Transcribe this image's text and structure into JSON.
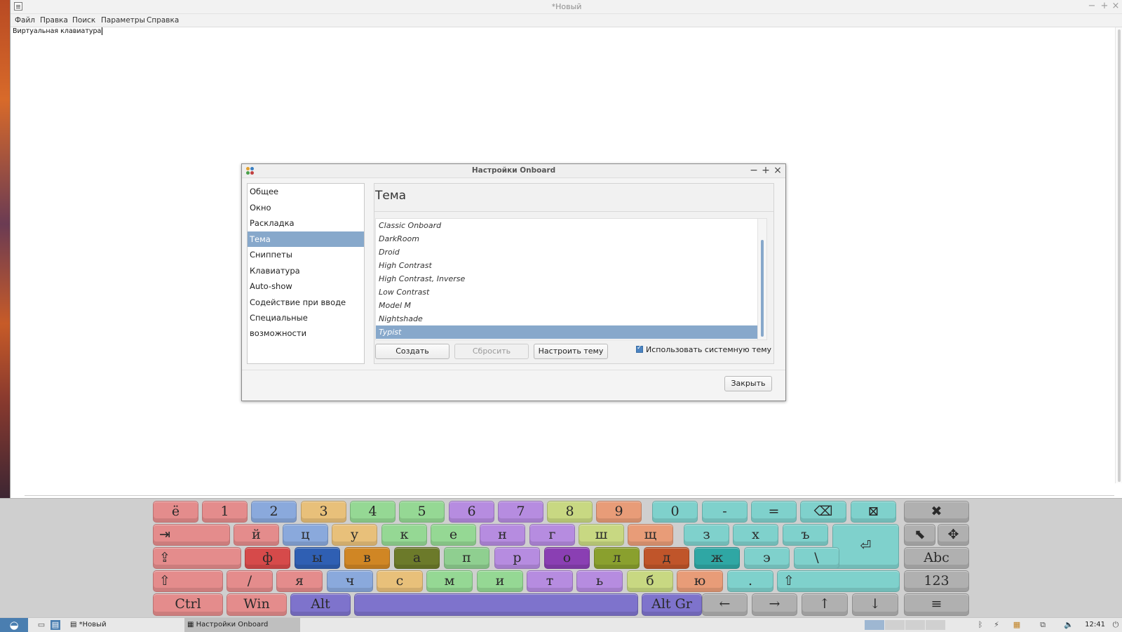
{
  "editor": {
    "title": "*Новый",
    "menu": [
      "Файл",
      "Правка",
      "Поиск",
      "Параметры",
      "Справка"
    ],
    "content": "Виртуальная клавиатура"
  },
  "dialog": {
    "title": "Настройки Onboard",
    "sidebar": [
      "Общее",
      "Окно",
      "Раскладка",
      "Тема",
      "Сниппеты",
      "Клавиатура",
      "Auto-show",
      "Содействие при вводе",
      "Специальные возможности"
    ],
    "sidebar_selected": "Тема",
    "heading": "Тема",
    "themes": [
      "Classic Onboard",
      "DarkRoom",
      "Droid",
      "High Contrast",
      "High Contrast, Inverse",
      "Low Contrast",
      "Model M",
      "Nightshade",
      "Typist"
    ],
    "theme_selected": "Typist",
    "buttons": {
      "create": "Создать",
      "reset": "Сбросить",
      "customize": "Настроить тему",
      "close": "Закрыть"
    },
    "use_system_theme": {
      "label": "Использовать системную тему",
      "checked": true
    }
  },
  "keyboard": {
    "rows": [
      [
        "ё",
        "1",
        "2",
        "3",
        "4",
        "5",
        "6",
        "7",
        "8",
        "9",
        "0",
        "-",
        "=",
        "⌫",
        "⊠",
        "✖"
      ],
      [
        "⇥",
        "й",
        "ц",
        "у",
        "к",
        "е",
        "н",
        "г",
        "ш",
        "щ",
        "з",
        "х",
        "ъ",
        "⏎",
        "⬉",
        "✥"
      ],
      [
        "⇪",
        "ф",
        "ы",
        "в",
        "а",
        "п",
        "р",
        "о",
        "л",
        "д",
        "ж",
        "э",
        "\\",
        "Abc"
      ],
      [
        "⇧",
        "/",
        "я",
        "ч",
        "с",
        "м",
        "и",
        "т",
        "ь",
        "б",
        "ю",
        ".",
        "⇧",
        "123"
      ],
      [
        "Ctrl",
        "Win",
        "Alt",
        "",
        "Alt Gr",
        "←",
        "→",
        "↑",
        "↓",
        "≡"
      ]
    ]
  },
  "taskbar": {
    "tasks": [
      "*Новый",
      "Настройки Onboard"
    ],
    "clock": "12:41"
  },
  "colors": {
    "selection": "#87a8cb",
    "keyboard_bg": "#cfcfcf"
  }
}
